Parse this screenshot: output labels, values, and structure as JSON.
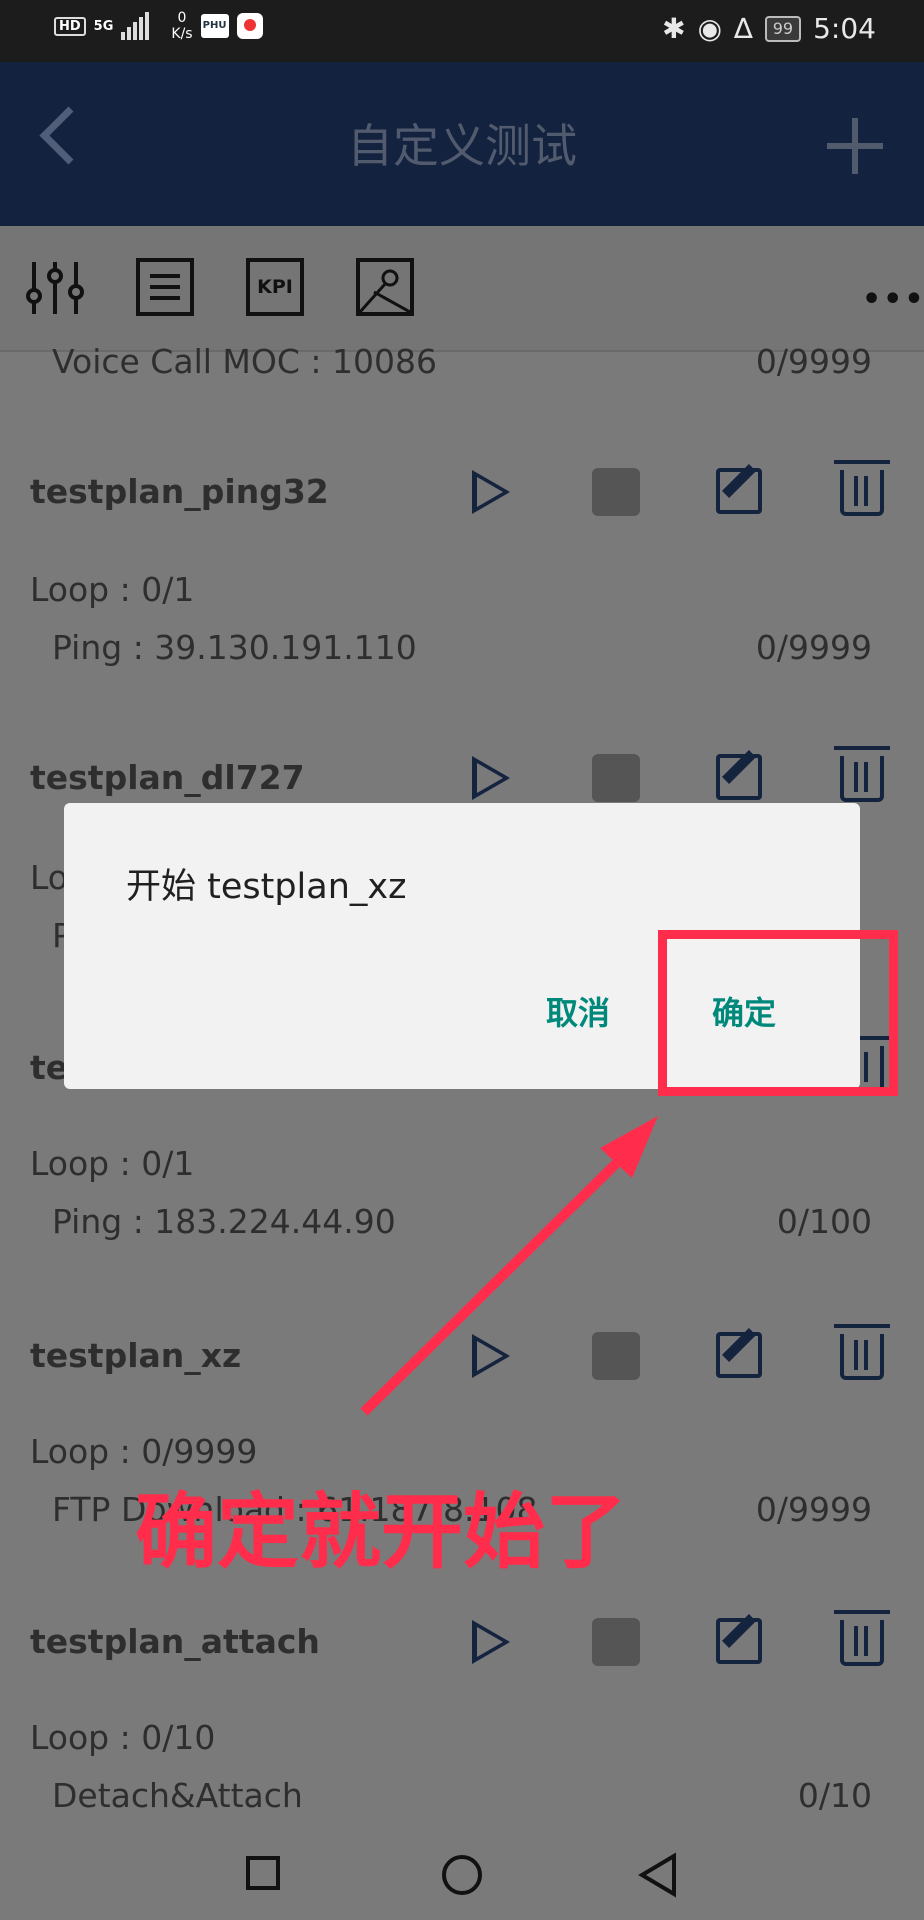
{
  "status_bar": {
    "hd": "HD",
    "network": "5G",
    "speed_top": "0",
    "speed_bottom": "K/s",
    "app1": "PHU",
    "battery": "99",
    "time": "5:04"
  },
  "header": {
    "title": "自定义测试"
  },
  "toolbar": {
    "kpi_label": "KPI",
    "more": "•••"
  },
  "top_row": {
    "label": "Voice Call MOC : 10086",
    "count": "0/9999"
  },
  "plans": [
    {
      "name": "testplan_ping32",
      "loop": "Loop : 0/1",
      "detail": "Ping : 39.130.191.110",
      "count": "0/9999"
    },
    {
      "name": "testplan_dl727",
      "loop": "Lo",
      "detail": "P",
      "count": ""
    },
    {
      "name": "te",
      "loop": "Loop : 0/1",
      "detail": "Ping : 183.224.44.90",
      "count": "0/100"
    },
    {
      "name": "testplan_xz",
      "loop": "Loop : 0/9999",
      "detail": "FTP Download : 61.187.8.108",
      "count": "0/9999"
    },
    {
      "name": "testplan_attach",
      "loop": "Loop : 0/10",
      "detail": "Detach&Attach",
      "count": "0/10"
    }
  ],
  "dialog": {
    "title": "开始 testplan_xz",
    "cancel": "取消",
    "ok": "确定"
  },
  "annotation": {
    "text": "确定就开始了",
    "color": "#ff2d4b"
  },
  "colors": {
    "header_bg": "#13223f",
    "accent": "#00897b",
    "icon": "#14243f"
  }
}
